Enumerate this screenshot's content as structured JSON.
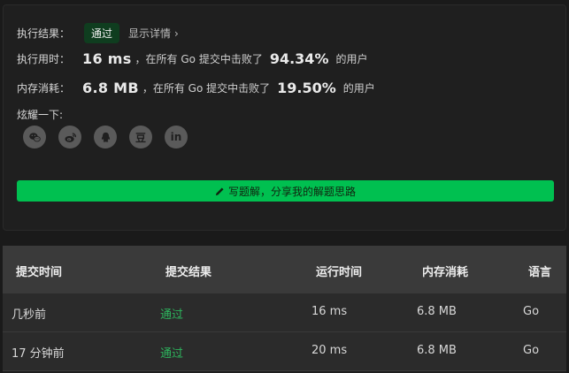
{
  "summary": {
    "result_label": "执行结果：",
    "result_badge": "通过",
    "detail_link": "显示详情",
    "detail_chevron": "›",
    "runtime_label": "执行用时：",
    "runtime_value": "16 ms",
    "runtime_mid": "，在所有 Go 提交中击败了",
    "runtime_pct": "94.34%",
    "runtime_suffix": "的用户",
    "memory_label": "内存消耗：",
    "memory_value": "6.8 MB",
    "memory_mid": "，在所有 Go 提交中击败了",
    "memory_pct": "19.50%",
    "memory_suffix": "的用户",
    "share_label": "炫耀一下:",
    "share_icons": [
      "wechat-icon",
      "weibo-icon",
      "qq-icon",
      "douban-icon",
      "linkedin-icon"
    ],
    "douban_glyph": "豆",
    "linkedin_glyph": "in",
    "write_button": "写题解，分享我的解题思路"
  },
  "table": {
    "headers": [
      "提交时间",
      "提交结果",
      "运行时间",
      "内存消耗",
      "语言"
    ],
    "rows": [
      [
        "几秒前",
        "通过",
        "16 ms",
        "6.8 MB",
        "Go"
      ],
      [
        "17 分钟前",
        "通过",
        "20 ms",
        "6.8 MB",
        "Go"
      ]
    ]
  },
  "colors": {
    "accent_green": "#00c050",
    "pass_text": "#2db55d",
    "background": "#1a1a1a"
  }
}
